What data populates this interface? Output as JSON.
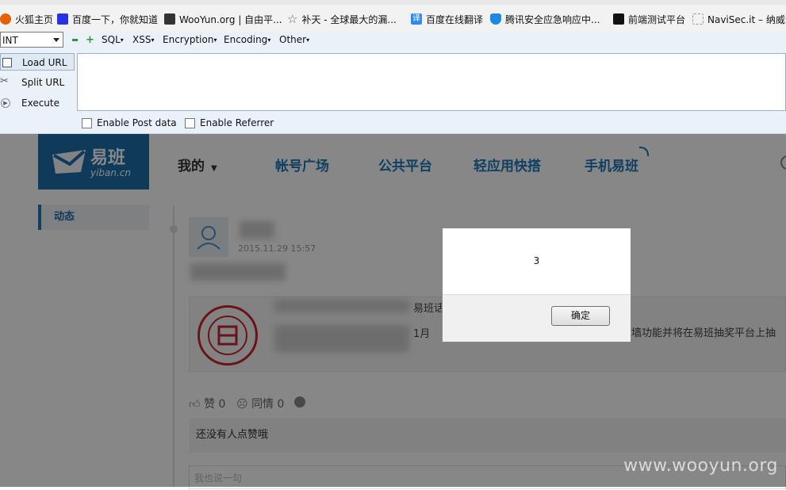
{
  "bookmarks": [
    {
      "label": "火狐主页",
      "icon": "firefox-icon",
      "color": "#e66000"
    },
    {
      "label": "百度一下，你就知道",
      "icon": "baidu-paw-icon",
      "color": "#2932e1"
    },
    {
      "label": "WooYun.org | 自由平...",
      "icon": "wooyun-icon",
      "color": "#333333"
    },
    {
      "label": "补天 - 全球最大的漏...",
      "icon": "star-outline-icon",
      "color": "#666666"
    },
    {
      "label": "百度在线翻译",
      "icon": "translate-icon",
      "color": "#2d8cf0"
    },
    {
      "label": "腾讯安全应急响应中...",
      "icon": "tencent-shield-icon",
      "color": "#1e88e5"
    },
    {
      "label": "前端测试平台",
      "icon": "spider-icon",
      "color": "#111111"
    },
    {
      "label": "NaviSec.it – 纳威安",
      "icon": "blank-page-icon",
      "color": "#999999"
    }
  ],
  "hackbar": {
    "select_value": "INT",
    "menus": [
      "SQL",
      "XSS",
      "Encryption",
      "Encoding",
      "Other"
    ],
    "buttons": {
      "load": "Load URL",
      "split": "Split URL",
      "execute": "Execute"
    },
    "url_value": "",
    "checks": {
      "post": "Enable Post data",
      "referrer": "Enable Referrer"
    }
  },
  "site": {
    "logo_text": "易班",
    "logo_sub": "yiban.cn",
    "nav": [
      "我的",
      "帐号广场",
      "公共平台",
      "轻应用快搭",
      "手机易班"
    ],
    "sidebar_item": "动态",
    "post_time": "2015.11.29 15:57",
    "share_title_fragment": "易班话",
    "share_line_fragment": "1月",
    "share_trailing_text": "墙功能并将在易班抽奖平台上抽",
    "like": "赞 0",
    "sympathy": "同情 0",
    "no_likes": "还没有人点赞哦",
    "comment_placeholder": "我也说一句"
  },
  "dialog": {
    "message": "3",
    "ok_button": "确定"
  },
  "watermark": "www.wooyun.org",
  "colors": {
    "brand_blue": "#1e78b8",
    "seal_red": "#c8272d",
    "hackbar_bg": "#eaf1f9"
  }
}
